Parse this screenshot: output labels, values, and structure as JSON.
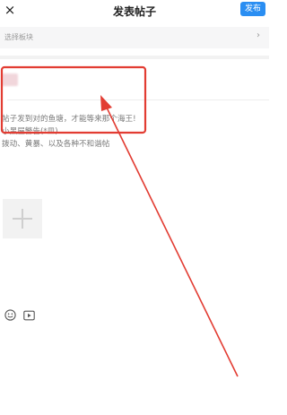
{
  "header": {
    "close_icon": "×",
    "title": "发表帖子",
    "publish_label": "发布"
  },
  "board_select": {
    "label": "选择板块",
    "chevron": "›"
  },
  "post": {
    "title_value": "",
    "body_lines": [
      "帖子发到对的鱼塘，才能等来那个海王!",
      "小黑屋警告(*皿)",
      "拨动、黄暴、以及各种不和谐帖"
    ]
  },
  "icons": {
    "add_image": "plus-icon",
    "emoji": "emoji-icon",
    "video": "video-icon"
  },
  "annotation": {
    "color": "#e23c32"
  },
  "colors": {
    "accent": "#2a8ef2",
    "panel": "#f6f6f7"
  }
}
